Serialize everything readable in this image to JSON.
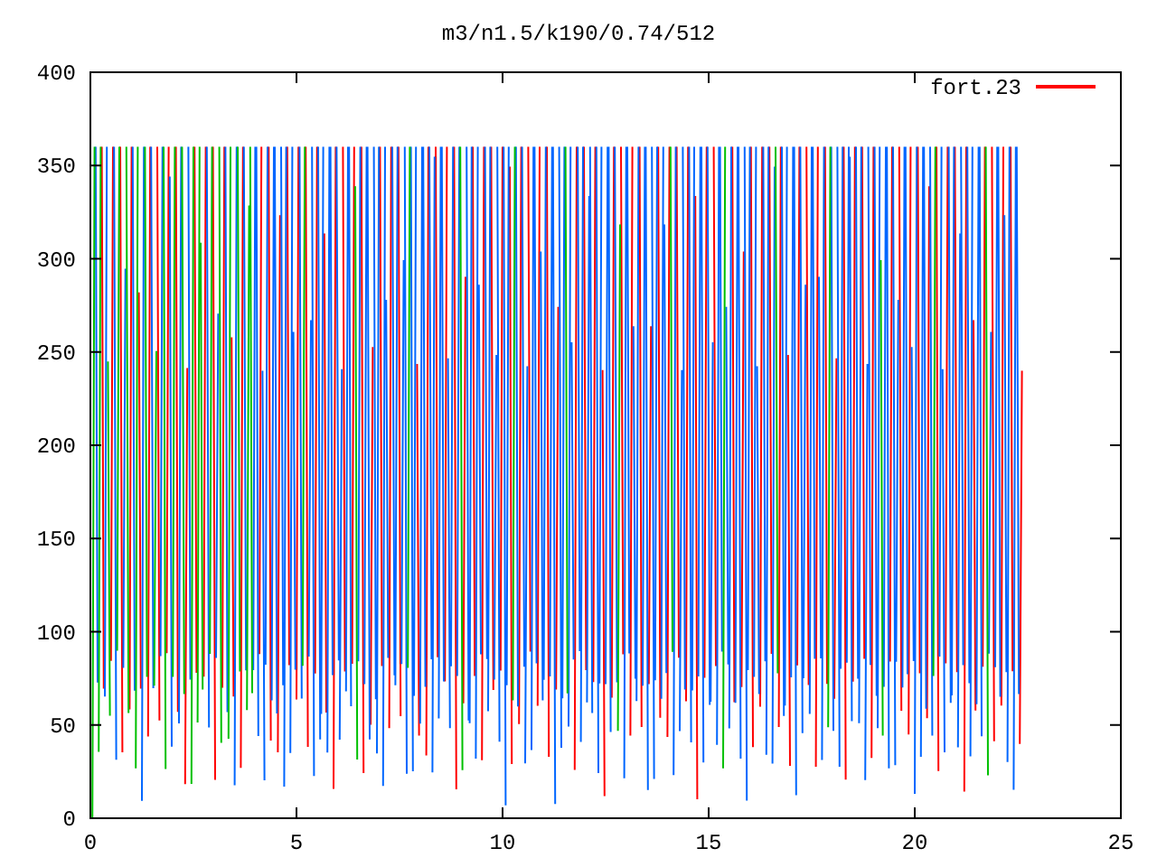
{
  "plot": {
    "title": "m3/n1.5/k190/0.74/512",
    "y_tick_labels": [
      "400",
      "350",
      "300",
      "250",
      "200",
      "150",
      "100",
      "50",
      "0"
    ],
    "x_tick_labels": [
      "0",
      "5",
      "10",
      "15",
      "20",
      "25"
    ],
    "legend": [
      {
        "label": "fort.23",
        "color": "#ff0000"
      }
    ]
  }
}
